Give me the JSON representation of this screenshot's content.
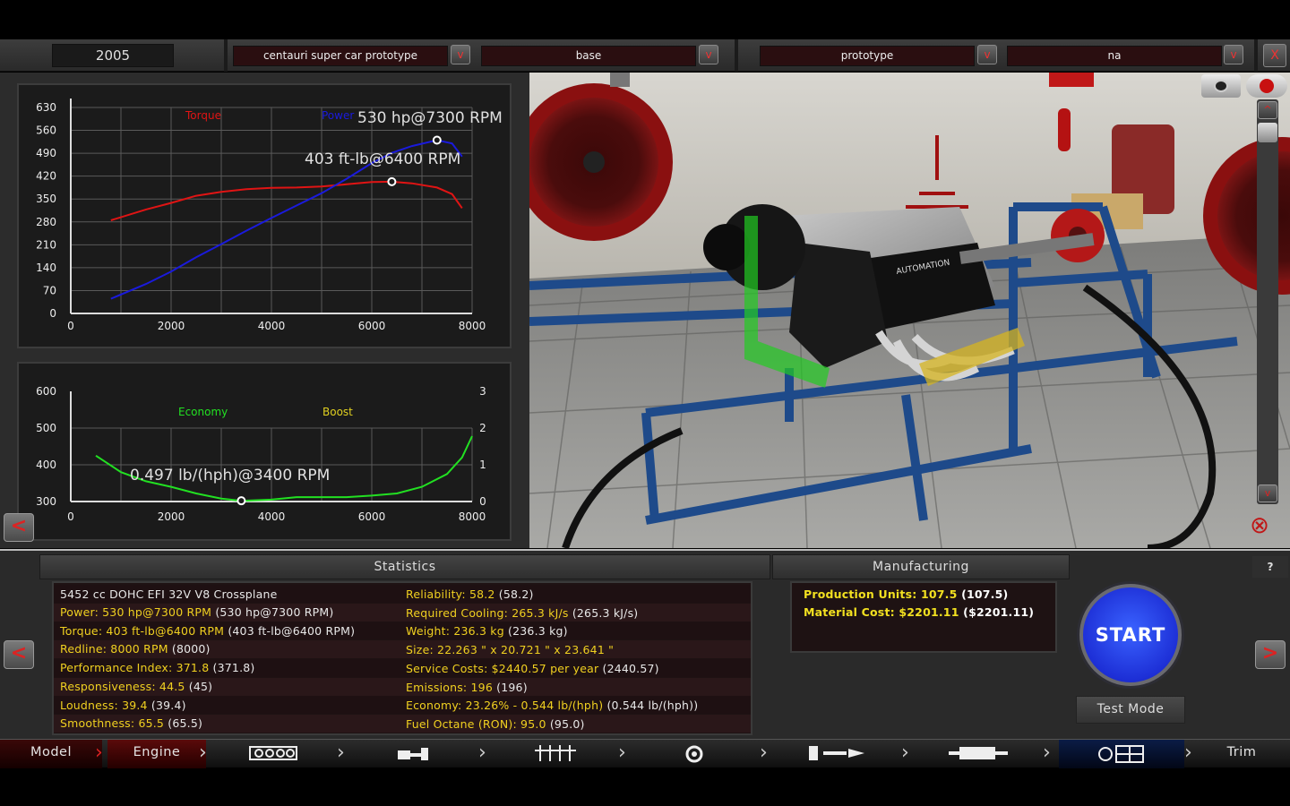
{
  "topbar": {
    "year": "2005",
    "family_name": "centauri super car prototype",
    "family_variant": "base",
    "engine_name": "prototype",
    "engine_variant": "na",
    "dropdown_glyph": "v",
    "close_glyph": "X"
  },
  "power_graph": {
    "torque_label": "Torque",
    "power_label": "Power",
    "power_peak_label": "530 hp@7300 RPM",
    "torque_peak_label": "403 ft-lb@6400 RPM",
    "y_ticks": [
      "630",
      "560",
      "490",
      "420",
      "350",
      "280",
      "210",
      "140",
      "70",
      "0"
    ],
    "x_ticks": [
      "0",
      "2000",
      "4000",
      "6000",
      "8000"
    ],
    "torque_color": "#e01414",
    "power_color": "#1a1adc"
  },
  "economy_graph": {
    "economy_label": "Economy",
    "boost_label": "Boost",
    "economy_peak_label": "0.497 lb/(hph)@3400 RPM",
    "y_ticks_left": [
      "600",
      "500",
      "400",
      "300"
    ],
    "y_ticks_right": [
      "3",
      "2",
      "1",
      "0"
    ],
    "x_ticks": [
      "0",
      "2000",
      "4000",
      "6000",
      "8000"
    ],
    "economy_color": "#22e022",
    "boost_color": "#e0d020"
  },
  "chart_data": [
    {
      "type": "line",
      "xlabel": "",
      "ylabel": "",
      "xlim": [
        0,
        8000
      ],
      "ylim": [
        0,
        630
      ],
      "x": [
        800,
        1500,
        2000,
        2500,
        3000,
        3500,
        4000,
        4500,
        5000,
        5500,
        6000,
        6400,
        6800,
        7300,
        7600,
        7800
      ],
      "series": [
        {
          "name": "Torque",
          "values": [
            285,
            318,
            338,
            360,
            372,
            380,
            384,
            385,
            388,
            395,
            402,
            403,
            398,
            385,
            365,
            322
          ]
        },
        {
          "name": "Power",
          "values": [
            45,
            90,
            128,
            172,
            212,
            253,
            292,
            330,
            368,
            412,
            460,
            491,
            512,
            530,
            520,
            480
          ]
        }
      ]
    },
    {
      "type": "line",
      "xlabel": "",
      "ylabel": "",
      "xlim": [
        0,
        8000
      ],
      "ylim": [
        300,
        600
      ],
      "y2lim": [
        0,
        3
      ],
      "x": [
        500,
        1000,
        1500,
        2000,
        2500,
        3000,
        3400,
        4000,
        4500,
        5000,
        5500,
        6000,
        6500,
        7000,
        7500,
        7800,
        8000
      ],
      "series": [
        {
          "name": "Economy",
          "values": [
            425,
            380,
            355,
            340,
            322,
            308,
            302,
            305,
            312,
            312,
            312,
            316,
            322,
            340,
            375,
            420,
            478
          ]
        },
        {
          "name": "Boost",
          "values": [
            0,
            0,
            0,
            0,
            0,
            0,
            0,
            0,
            0,
            0,
            0,
            0,
            0,
            0,
            0,
            0,
            0
          ]
        }
      ]
    }
  ],
  "statistics": {
    "title": "Statistics",
    "engine_desc": "5452 cc DOHC EFI 32V V8 Crossplane",
    "left": [
      {
        "label": "Power: 530 hp@7300 RPM",
        "value": " (530 hp@7300 RPM)"
      },
      {
        "label": "Torque: 403 ft-lb@6400 RPM",
        "value": " (403 ft-lb@6400 RPM)"
      },
      {
        "label": "Redline: 8000 RPM",
        "value": " (8000)"
      },
      {
        "label": "Performance Index: 371.8",
        "value": " (371.8)"
      },
      {
        "label": "Responsiveness: 44.5",
        "value": " (45)"
      },
      {
        "label": "Loudness: 39.4",
        "value": " (39.4)"
      },
      {
        "label": "Smoothness: 65.5",
        "value": " (65.5)"
      }
    ],
    "right": [
      {
        "label": "Reliability: 58.2",
        "value": " (58.2)"
      },
      {
        "label": "Required Cooling: 265.3 kJ/s",
        "value": " (265.3 kJ/s)"
      },
      {
        "label": "Weight: 236.3 kg",
        "value": " (236.3 kg)"
      },
      {
        "label": "Size: 22.263 \" x 20.721 \" x 23.641 \"",
        "value": ""
      },
      {
        "label": "Service Costs: $2440.57 per year",
        "value": " (2440.57)"
      },
      {
        "label": "Emissions: 196",
        "value": " (196)"
      },
      {
        "label": "Economy: 23.26% - 0.544 lb/(hph)",
        "value": " (0.544 lb/(hph))"
      },
      {
        "label": "Fuel Octane (RON): 95.0",
        "value": " (95.0)"
      }
    ]
  },
  "manufacturing": {
    "title": "Manufacturing",
    "rows": [
      {
        "label": "Production Units: 107.5",
        "value": " (107.5)"
      },
      {
        "label": "Material Cost: $2201.11",
        "value": " ($2201.11)"
      }
    ]
  },
  "actions": {
    "start": "START",
    "test_mode": "Test Mode",
    "help": "?",
    "prev": "<",
    "next": ">"
  },
  "nav": {
    "model": "Model",
    "engine": "Engine",
    "trim": "Trim",
    "icons": [
      "block-icon",
      "crank-icon",
      "heads-icon",
      "turbo-icon",
      "fuel-icon",
      "exhaust-icon",
      "testbench-icon"
    ]
  },
  "viewport": {
    "brand": "AUTOMATION"
  }
}
